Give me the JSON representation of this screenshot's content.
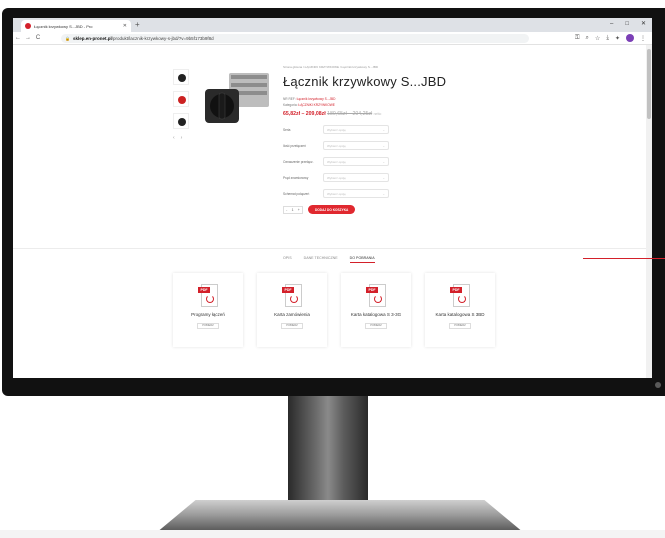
{
  "browser": {
    "tab_title": "Łącznik krzywkowy S...JBD - Pro",
    "tab_close": "✕",
    "new_tab": "+",
    "win_minimize": "–",
    "win_maximize": "□",
    "win_close": "✕",
    "back": "←",
    "forward": "→",
    "reload": "C",
    "url_host": "sklep.en-pronet.pl",
    "url_path": "/produkt/lacznik-krzywkowy-s-jbd/?v=9b5f173b9f8d"
  },
  "product": {
    "breadcrumb": "Strona główna / ŁĄCZNIKI KRZYWKOWE / Łącznik krzywkowy S...JBD",
    "title": "Łącznik krzywkowy S...JBD",
    "sku_label": "NR REF:",
    "sku_value": "Łącznik krzywkowy S...JBD",
    "category_label": "Kategoria:",
    "category_value": "ŁĄCZNIKI KRZYWKOWE",
    "price_range": "65,82zł – 209,08zł",
    "price_old": "180,65zł – 204,25zł",
    "price_net": "netto",
    "options": [
      {
        "label": "Seria",
        "placeholder": "Wybierz opcję"
      },
      {
        "label": "Ilość przełączeń",
        "placeholder": "Wybierz opcję"
      },
      {
        "label": "Oznaczenie przełącz.",
        "placeholder": "Wybierz opcję"
      },
      {
        "label": "Prąd znamionowy",
        "placeholder": "Wybierz opcję"
      },
      {
        "label": "Schemat połączeń",
        "placeholder": "Wybierz opcję"
      }
    ],
    "qty_minus": "-",
    "qty_value": "1",
    "qty_plus": "+",
    "add_to_cart": "DODAJ DO KOSZYKA"
  },
  "tabs": [
    {
      "label": "OPIS",
      "active": false
    },
    {
      "label": "DANE TECHNICZNE",
      "active": false
    },
    {
      "label": "DO POBRANIA",
      "active": true
    }
  ],
  "downloads": [
    {
      "name": "Programy łączeń",
      "button": "POBIERZ"
    },
    {
      "name": "Karta zamówienia",
      "button": "POBIERZ"
    },
    {
      "name": "Karta katalogowa S 3-3G",
      "button": "POBIERZ"
    },
    {
      "name": "Karta katalogowa S 3BD",
      "button": "POBIERZ"
    }
  ],
  "pdf_badge": "PDF",
  "colors": {
    "accent": "#d3202a",
    "bezel": "#111111"
  }
}
